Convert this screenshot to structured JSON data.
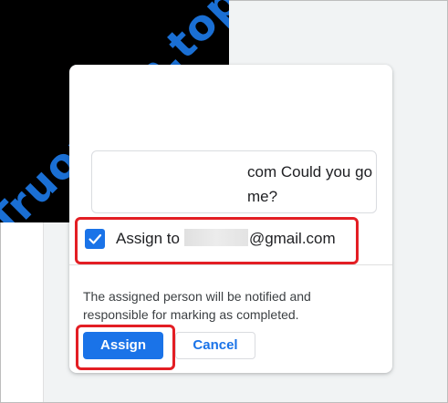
{
  "watermark": {
    "text": "Truongtin.top",
    "background_color": "#000000",
    "text_color": "#1a6fd4"
  },
  "comment": {
    "line1": "com Could you go",
    "line2": "me?"
  },
  "assign": {
    "checked": true,
    "label_prefix": "Assign to",
    "email_suffix": "@gmail.com",
    "checkbox_icon": "check-icon"
  },
  "notice": {
    "text": "The assigned person will be notified and responsible for marking as completed."
  },
  "buttons": {
    "assign_label": "Assign",
    "cancel_label": "Cancel"
  },
  "colors": {
    "accent": "#1a73e8",
    "highlight": "#e31e24"
  }
}
